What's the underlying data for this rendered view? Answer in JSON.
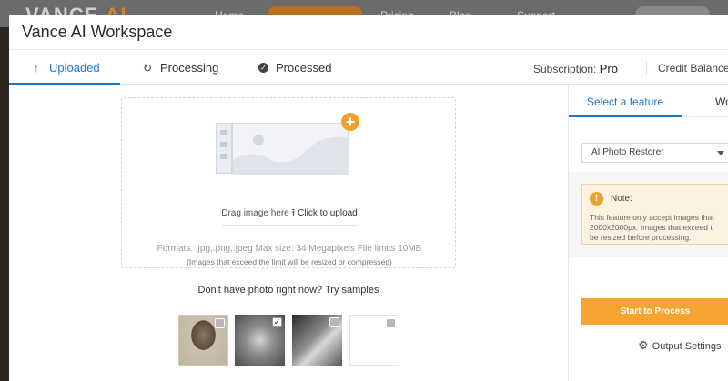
{
  "background": {
    "logo_a": "VANCE",
    "logo_b": "AI",
    "nav": [
      "Home",
      "Pricing",
      "Blog",
      "Support"
    ]
  },
  "modal": {
    "title": "Vance AI Workspace",
    "tabs": [
      {
        "label": "Uploaded",
        "icon": "up-arrow-icon",
        "active": true
      },
      {
        "label": "Processing",
        "icon": "refresh-icon",
        "active": false
      },
      {
        "label": "Processed",
        "icon": "check-circle-icon",
        "active": false
      }
    ],
    "subscription_label": "Subscription:",
    "subscription_value": "Pro",
    "credit_label": "Credit Balance:"
  },
  "upload": {
    "drag_text": "Drag image here",
    "upload_link": "Click to upload",
    "formats": "Formats: .jpg,.png,.jpeg Max size: 34 Megapixels File limits 10MB",
    "limit_note": "(Images that exceed the limit will be resized or compressed)"
  },
  "samples": {
    "title": "Don't have photo right now? Try samples",
    "items": [
      {
        "checked": false
      },
      {
        "checked": true
      },
      {
        "checked": false
      },
      {
        "checked": false
      }
    ]
  },
  "side": {
    "tab_active": "Select a feature",
    "tab_other": "Wo",
    "select_value": "AI Photo Restorer",
    "note_title": "Note:",
    "note_lines": [
      "This feature only accept images that",
      "2000x2000px. Images that exceed t",
      "be resized before processing."
    ],
    "start_button": "Start to Process",
    "output_settings": "Output Settings"
  },
  "colors": {
    "accent_blue": "#1f76cf",
    "accent_orange": "#f5a431"
  }
}
